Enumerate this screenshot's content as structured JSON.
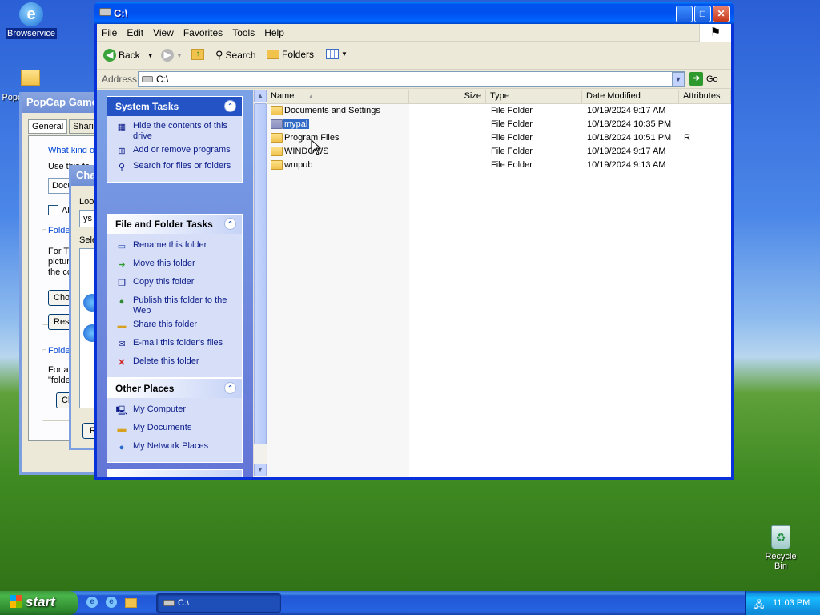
{
  "desktop": {
    "icons": [
      {
        "label": "Browservice"
      },
      {
        "label": "Recycle Bin"
      }
    ],
    "partial_icon_label": "Popc"
  },
  "bg_windows": {
    "popcap": {
      "title": "PopCap Games",
      "tabs": [
        "General",
        "Sharin"
      ],
      "texts": [
        "What kind of",
        "Use this fo",
        "Docu",
        "Als",
        "Folder",
        "For Th",
        "picture",
        "the co",
        "Choo",
        "Res",
        "Folder",
        "For all",
        "\"folde",
        "Cha"
      ]
    },
    "change_dialog": {
      "title": "Cha",
      "texts": [
        "Loo",
        "ys",
        "Sele",
        "R"
      ]
    }
  },
  "explorer": {
    "title": "C:\\",
    "menu": [
      "File",
      "Edit",
      "View",
      "Favorites",
      "Tools",
      "Help"
    ],
    "toolbar": {
      "back": "Back",
      "search": "Search",
      "folders": "Folders"
    },
    "address": {
      "label": "Address",
      "value": "C:\\",
      "go": "Go"
    },
    "system_tasks": {
      "title": "System Tasks",
      "items": [
        {
          "label": "Hide the contents of this drive",
          "icon": "hide-icon"
        },
        {
          "label": "Add or remove programs",
          "icon": "add-remove-icon"
        },
        {
          "label": "Search for files or folders",
          "icon": "search-icon"
        }
      ]
    },
    "file_folder_tasks": {
      "title": "File and Folder Tasks",
      "items": [
        {
          "label": "Rename this folder",
          "icon": "rename-icon"
        },
        {
          "label": "Move this folder",
          "icon": "move-icon"
        },
        {
          "label": "Copy this folder",
          "icon": "copy-icon"
        },
        {
          "label": "Publish this folder to the Web",
          "icon": "globe-icon"
        },
        {
          "label": "Share this folder",
          "icon": "share-icon"
        },
        {
          "label": "E-mail this folder's files",
          "icon": "email-icon"
        },
        {
          "label": "Delete this folder",
          "icon": "delete-icon"
        }
      ]
    },
    "other_places": {
      "title": "Other Places",
      "items": [
        {
          "label": "My Computer",
          "icon": "computer-icon"
        },
        {
          "label": "My Documents",
          "icon": "documents-icon"
        },
        {
          "label": "My Network Places",
          "icon": "network-icon"
        }
      ]
    },
    "columns": [
      "Name",
      "Size",
      "Type",
      "Date Modified",
      "Attributes"
    ],
    "files": [
      {
        "name": "Documents and Settings",
        "size": "",
        "type": "File Folder",
        "date": "10/19/2024 9:17 AM",
        "attr": ""
      },
      {
        "name": "mypal",
        "size": "",
        "type": "File Folder",
        "date": "10/18/2024 10:35 PM",
        "attr": "",
        "selected": true
      },
      {
        "name": "Program Files",
        "size": "",
        "type": "File Folder",
        "date": "10/18/2024 10:51 PM",
        "attr": "R"
      },
      {
        "name": "WINDOWS",
        "size": "",
        "type": "File Folder",
        "date": "10/19/2024 9:17 AM",
        "attr": ""
      },
      {
        "name": "wmpub",
        "size": "",
        "type": "File Folder",
        "date": "10/19/2024 9:13 AM",
        "attr": ""
      }
    ]
  },
  "taskbar": {
    "start": "start",
    "task_button": "C:\\",
    "clock": "11:03 PM"
  },
  "colors": {
    "title_blue": "#0053ee",
    "selection": "#316ac5",
    "start_green": "#3c9a3c"
  }
}
